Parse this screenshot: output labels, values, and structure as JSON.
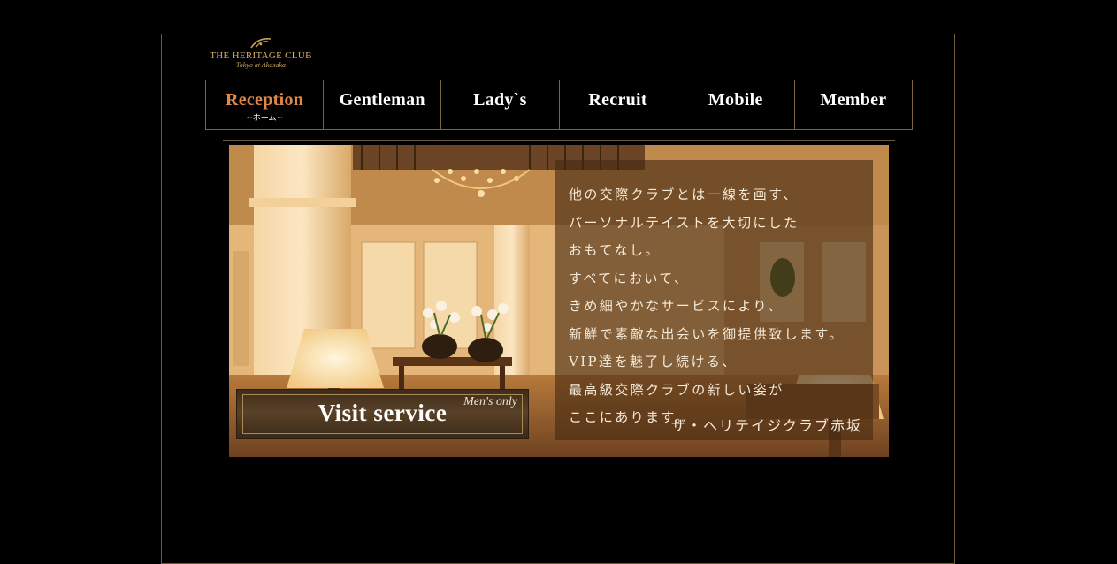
{
  "logo": {
    "name": "The Heritage Club",
    "sub": "Tokyo at Akasaka"
  },
  "nav": {
    "items": [
      {
        "label": "Reception",
        "sublabel": "~ホーム~",
        "active": true
      },
      {
        "label": "Gentleman"
      },
      {
        "label": "Lady`s"
      },
      {
        "label": "Recruit"
      },
      {
        "label": "Mobile"
      },
      {
        "label": "Member"
      }
    ]
  },
  "hero": {
    "lines": [
      "他の交際クラブとは一線を画す、",
      "パーソナルテイストを大切にした",
      "おもてなし。",
      "すべてにおいて、",
      "きめ細やかなサービスにより、",
      "新鮮で素敵な出会いを御提供致します。",
      "VIP達を魅了し続ける、",
      "最高級交際クラブの新しい姿が",
      "ここにあります。"
    ],
    "signature": "ザ・ヘリテイジクラブ赤坂",
    "visit": {
      "label": "Visit service",
      "tag": "Men's only"
    }
  },
  "colors": {
    "background": "#000000",
    "accent": "#e0884a",
    "gold": "#c9a35b",
    "border": "#7a6440"
  }
}
